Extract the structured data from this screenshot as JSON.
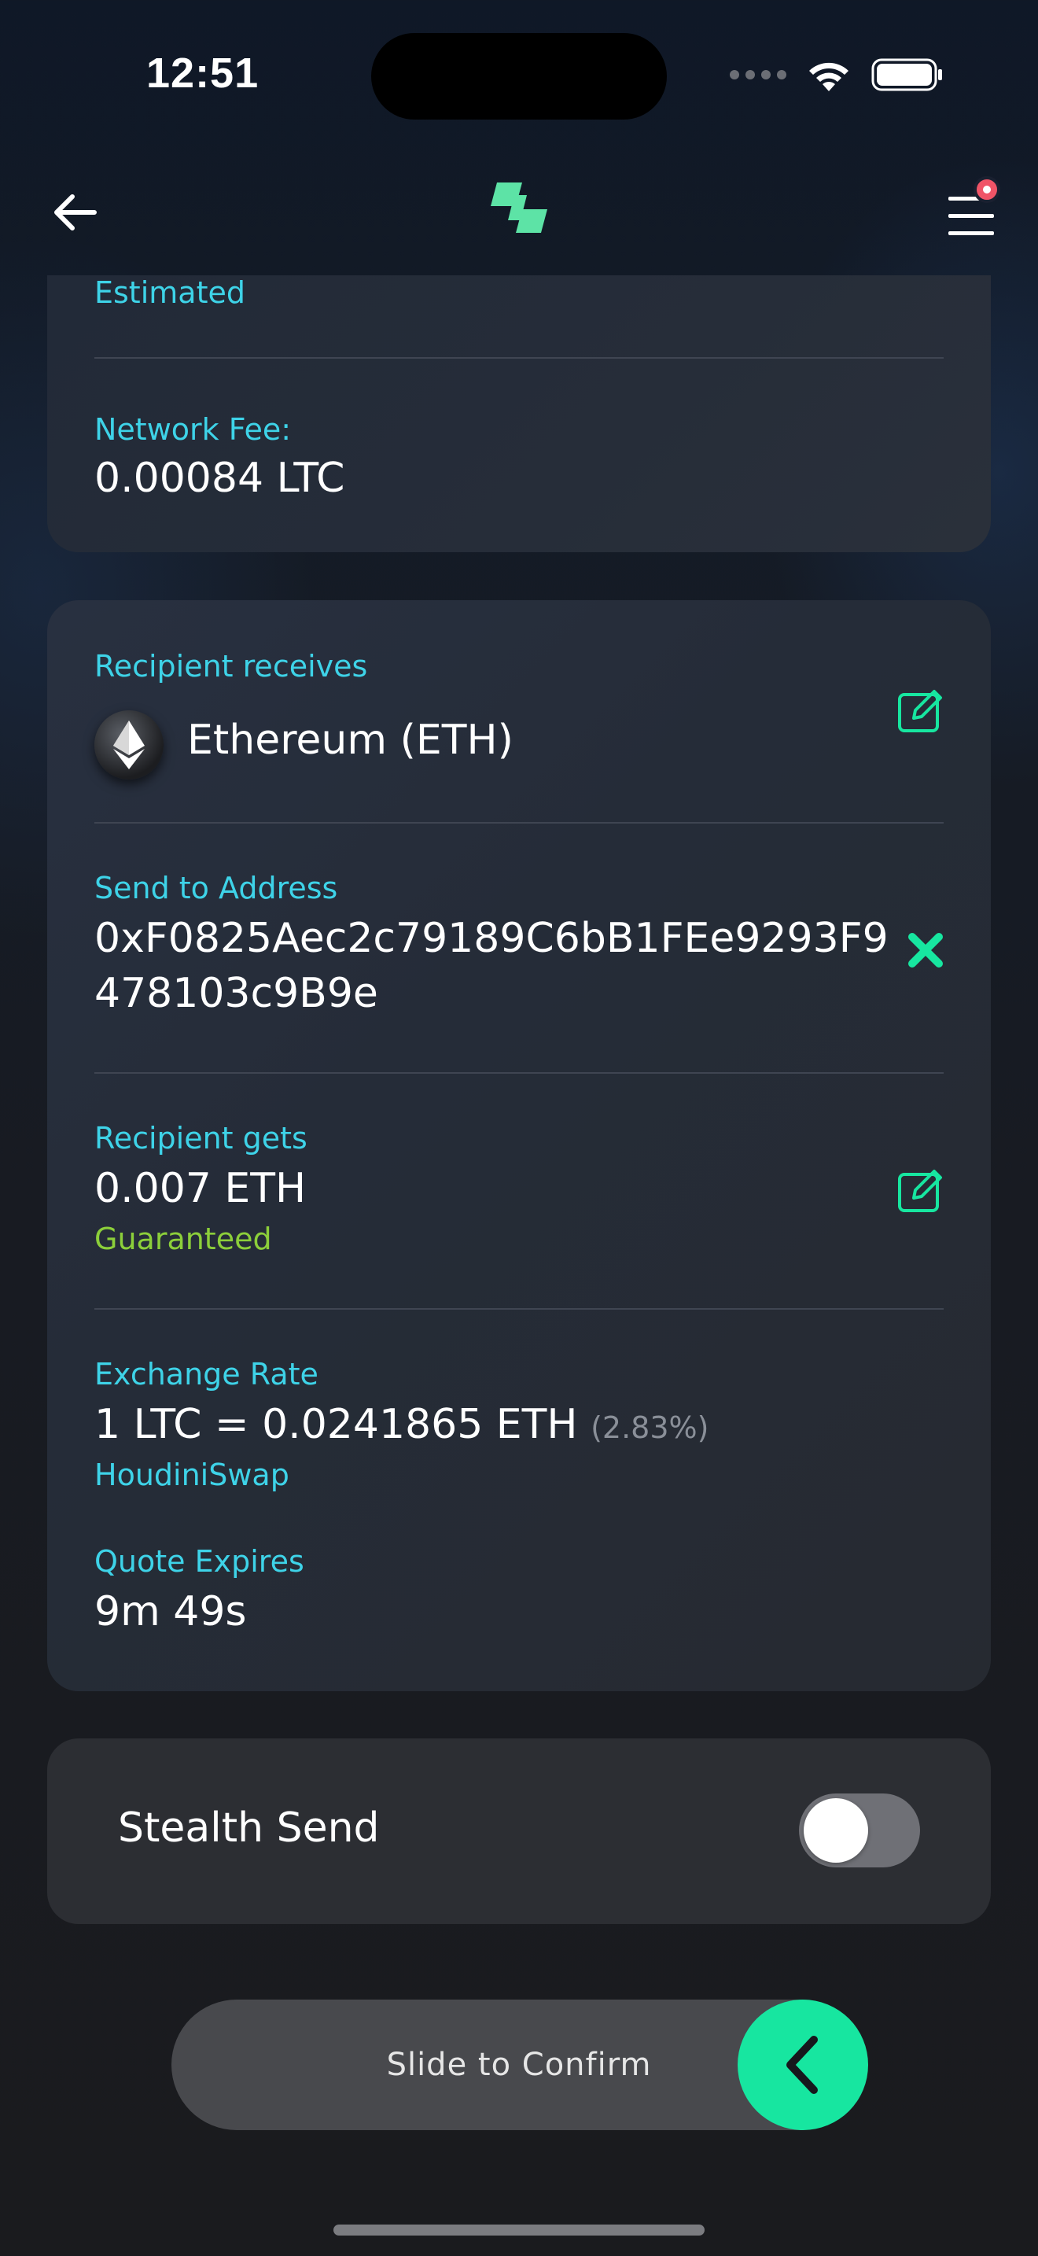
{
  "status_bar": {
    "time": "12:51"
  },
  "colors": {
    "accent": "#17e6a0",
    "label": "#3ed3e8",
    "guaranteed": "#8ccf3a",
    "badge": "#f05467"
  },
  "nav": {
    "back_icon": "arrow-left-icon",
    "logo_icon": "brand-logo-icon",
    "menu_icon": "hamburger-menu-icon"
  },
  "top_card": {
    "estimated_label": "Estimated",
    "network_fee_label": "Network Fee:",
    "network_fee_value": "0.00084 LTC"
  },
  "main_card": {
    "recipient_receives_label": "Recipient receives",
    "recipient_receives_value": "Ethereum (ETH)",
    "send_to_label": "Send to Address",
    "address_line1": "0xF0825Aec2c79189C6bB1FEe9293F9",
    "address_line2": "478103c9B9e",
    "recipient_gets_label": "Recipient gets",
    "recipient_gets_value": "0.007 ETH",
    "guaranteed_label": "Guaranteed",
    "exchange_rate_label": "Exchange Rate",
    "exchange_rate_value": "1 LTC = 0.0241865 ETH",
    "exchange_rate_pct": "(2.83%)",
    "provider": "HoudiniSwap",
    "quote_expires_label": "Quote Expires",
    "quote_expires_value": "9m 49s"
  },
  "stealth": {
    "label": "Stealth Send",
    "enabled": false
  },
  "slider": {
    "label": "Slide to Confirm"
  }
}
